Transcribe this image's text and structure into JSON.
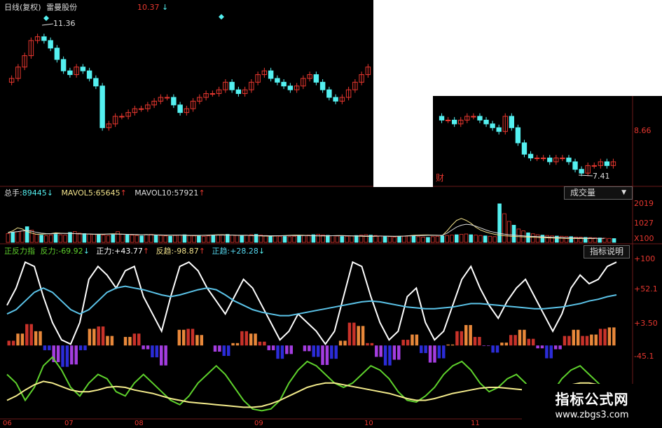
{
  "price_panel": {
    "title": "日线(复权)",
    "stock_name": "雷曼股份",
    "top_value": "10.37",
    "top_arrow": "↓",
    "high_marker": "11.36",
    "low_marker": "7.41",
    "finance_marker": "财",
    "right_axis_value": "8.66"
  },
  "volume_panel": {
    "label_total": "总手:",
    "total_value": "89445",
    "total_arrow": "↓",
    "label_ma5": "MAVOL5:",
    "ma5_value": "65645",
    "ma5_arrow": "↑",
    "label_ma10": "MAVOL10:",
    "ma10_value": "57921",
    "ma10_arrow": "↑",
    "dropdown_label": "成交量",
    "dropdown_arrow": "▼",
    "axis_top": "2019",
    "axis_mid": "1027",
    "axis_unit": "X100"
  },
  "indicator_panel": {
    "name": "正反力指",
    "label_fanli": "反力:",
    "fanli_value": "-69.92",
    "fanli_arrow": "↓",
    "label_zhengli": "正力:",
    "zhengli_value": "+43.77",
    "zhengli_arrow": "↑",
    "label_fanqu": "反趋:",
    "fanqu_value": "-98.87",
    "fanqu_arrow": "↑",
    "label_zhengqu": "正趋:",
    "zhengqu_value": "+28.28",
    "zhengqu_arrow": "↓",
    "help_button": "指标说明",
    "axis_labels": [
      "+100",
      "+52.1",
      "+3.50",
      "-45.1"
    ]
  },
  "x_axis_labels": [
    "06",
    "07",
    "08",
    "09",
    "10",
    "11"
  ],
  "watermark": {
    "line1": "指标公式网",
    "line2": "www.zbgs3.com"
  },
  "colors": {
    "up": "#e8372f",
    "down": "#54f0f0",
    "ma": "#ffffff",
    "white_line": "#ffffff",
    "blue_line": "#5bc3e8",
    "green_line": "#5ed12c",
    "yellow_line": "#f4ec8c",
    "bar_red": "#c8322a",
    "bar_orange": "#e8883a",
    "bar_blue": "#2b2cd8",
    "bar_purple": "#a43de0",
    "label_yellow": "#f0e08a",
    "label_green": "#5ed12c",
    "label_cyan": "#55d8f0"
  },
  "chart_data": [
    {
      "type": "candlestick",
      "title": "日线(复权) 雷曼股份",
      "ylim": [
        7.2,
        11.6
      ],
      "series": [
        {
          "name": "segment1",
          "open": [
            9.8,
            9.9,
            10.2,
            10.5,
            10.9,
            11.0,
            10.9,
            10.7,
            10.4,
            10.1,
            10.0,
            10.2,
            10.1,
            9.9,
            9.7,
            8.6,
            8.7,
            8.9,
            8.9,
            9.0,
            9.1,
            9.1,
            9.2,
            9.3,
            9.4,
            9.4,
            9.2,
            9.0,
            9.1,
            9.3,
            9.4,
            9.5,
            9.5,
            9.6,
            9.8,
            9.6,
            9.5,
            9.6,
            9.8,
            10.0,
            10.1,
            9.9,
            9.8,
            9.7,
            9.6,
            9.7,
            9.9,
            10.0,
            9.8,
            9.6,
            9.4,
            9.3,
            9.4,
            9.6,
            9.8,
            10.0
          ],
          "close": [
            9.9,
            10.2,
            10.5,
            10.9,
            11.0,
            10.9,
            10.7,
            10.4,
            10.1,
            10.0,
            10.2,
            10.1,
            9.9,
            9.7,
            8.6,
            8.7,
            8.9,
            8.9,
            9.0,
            9.1,
            9.1,
            9.2,
            9.3,
            9.4,
            9.4,
            9.2,
            9.0,
            9.1,
            9.3,
            9.4,
            9.5,
            9.5,
            9.6,
            9.8,
            9.6,
            9.5,
            9.6,
            9.8,
            10.0,
            10.1,
            9.9,
            9.8,
            9.7,
            9.6,
            9.7,
            9.9,
            10.0,
            9.8,
            9.6,
            9.4,
            9.3,
            9.4,
            9.6,
            9.8,
            10.0,
            10.2
          ]
        },
        {
          "name": "segment2",
          "open": [
            8.9,
            8.8,
            8.8,
            8.7,
            8.8,
            8.9,
            8.9,
            8.8,
            8.7,
            8.6,
            8.5,
            8.9,
            8.6,
            8.2,
            7.9,
            7.8,
            7.8,
            7.8,
            7.7,
            7.8,
            7.8,
            7.7,
            7.5,
            7.4,
            7.6,
            7.6,
            7.7,
            7.6
          ],
          "close": [
            8.8,
            8.8,
            8.7,
            8.8,
            8.9,
            8.9,
            8.8,
            8.7,
            8.6,
            8.5,
            8.9,
            8.6,
            8.2,
            7.9,
            7.8,
            7.8,
            7.8,
            7.7,
            7.8,
            7.8,
            7.7,
            7.5,
            7.4,
            7.6,
            7.6,
            7.7,
            7.6,
            7.7
          ]
        }
      ],
      "annotations": [
        "11.36",
        "7.41",
        "10.37",
        "8.66"
      ]
    },
    {
      "type": "bar",
      "title": "成交量",
      "ylim": [
        0,
        2200
      ],
      "series": [
        {
          "name": "总手",
          "values": [
            460,
            520,
            560,
            600,
            820,
            640,
            420,
            380,
            350,
            380,
            420,
            400,
            380,
            520,
            560,
            480,
            460,
            440,
            420,
            400,
            380,
            360,
            400,
            560,
            420,
            400,
            380,
            360,
            340,
            400,
            420,
            380,
            360,
            340,
            320,
            360,
            380,
            400,
            360,
            340,
            330,
            320,
            340,
            360,
            380,
            400,
            420,
            380,
            360,
            340,
            380,
            400,
            420,
            380,
            360,
            340,
            330,
            320,
            310,
            300,
            320,
            340,
            360,
            380,
            400,
            420,
            390,
            370,
            350,
            330,
            310,
            320,
            340,
            360,
            380,
            400,
            380,
            360,
            340,
            320,
            300,
            280,
            300,
            320,
            340,
            360,
            300,
            280,
            260,
            300,
            320,
            340,
            360,
            380,
            400,
            420,
            440,
            400,
            380,
            360,
            340,
            320,
            300,
            2019,
            1500,
            1100,
            900,
            700,
            600,
            500,
            450,
            400,
            380,
            360,
            340,
            330,
            320,
            310,
            300,
            280,
            270,
            260,
            250,
            240,
            230,
            220,
            210,
            200
          ]
        },
        {
          "name": "MAVOL5",
          "values": [
            520,
            600,
            760,
            700,
            560,
            480,
            420,
            430,
            440,
            460,
            500,
            480,
            470,
            470,
            460,
            450,
            440,
            430,
            420,
            410,
            420,
            440,
            450,
            440,
            430,
            420,
            410,
            400,
            400,
            410,
            400,
            390,
            380,
            370,
            370,
            380,
            380,
            370,
            360,
            360,
            360,
            370,
            380,
            390,
            400,
            400,
            390,
            380,
            370,
            370,
            370,
            360,
            350,
            340,
            330,
            330,
            340,
            350,
            360,
            370,
            380,
            380,
            370,
            360,
            350,
            340,
            340,
            340,
            350,
            360,
            360,
            350,
            340,
            330,
            320,
            310,
            310,
            320,
            330,
            330,
            320,
            310,
            320,
            330,
            350,
            370,
            380,
            390,
            390,
            380,
            370,
            360,
            600,
            900,
            1150,
            1250,
            1150,
            1000,
            800,
            650,
            550,
            480,
            420,
            380,
            350,
            330,
            310,
            300,
            290,
            280,
            270,
            260,
            250,
            240,
            230,
            220,
            220,
            210,
            210,
            200,
            200,
            200,
            200,
            200
          ]
        },
        {
          "name": "MAVOL10",
          "values": [
            500,
            540,
            560,
            600,
            620,
            580,
            520,
            480,
            460,
            450,
            460,
            470,
            470,
            470,
            460,
            450,
            440,
            440,
            430,
            430,
            430,
            430,
            430,
            430,
            420,
            420,
            410,
            410,
            400,
            400,
            400,
            390,
            390,
            380,
            380,
            380,
            380,
            380,
            370,
            370,
            370,
            370,
            370,
            380,
            380,
            380,
            380,
            380,
            370,
            370,
            370,
            360,
            360,
            350,
            350,
            350,
            350,
            350,
            350,
            360,
            360,
            360,
            360,
            360,
            350,
            350,
            350,
            350,
            350,
            350,
            350,
            350,
            340,
            340,
            340,
            330,
            330,
            330,
            330,
            330,
            320,
            320,
            320,
            330,
            340,
            350,
            360,
            360,
            370,
            370,
            370,
            370,
            480,
            640,
            800,
            900,
            950,
            920,
            850,
            760,
            660,
            580,
            520,
            470,
            430,
            400,
            380,
            360,
            340,
            320,
            310,
            300,
            290,
            280,
            270,
            260,
            250,
            240,
            240,
            230,
            230,
            220,
            220,
            210,
            210,
            210
          ]
        }
      ],
      "annotations": [
        "2019",
        "1027",
        "X100"
      ]
    },
    {
      "type": "line",
      "title": "正反力指",
      "ylim": [
        -75,
        105
      ],
      "series": [
        {
          "name": "正力",
          "values": [
            50,
            70,
            100,
            95,
            60,
            30,
            10,
            5,
            30,
            80,
            95,
            85,
            70,
            90,
            95,
            60,
            40,
            20,
            60,
            95,
            100,
            90,
            70,
            55,
            40,
            60,
            80,
            70,
            50,
            30,
            10,
            20,
            40,
            30,
            20,
            5,
            20,
            60,
            100,
            95,
            60,
            30,
            10,
            20,
            60,
            70,
            30,
            10,
            20,
            50,
            80,
            95,
            70,
            50,
            35,
            55,
            70,
            80,
            60,
            40,
            20,
            40,
            70,
            85,
            75,
            80,
            95,
            100
          ]
        },
        {
          "name": "正趋",
          "values": [
            40,
            45,
            55,
            65,
            70,
            65,
            55,
            45,
            40,
            45,
            55,
            65,
            70,
            72,
            70,
            68,
            65,
            62,
            60,
            62,
            65,
            68,
            70,
            68,
            62,
            55,
            50,
            45,
            42,
            40,
            38,
            38,
            40,
            42,
            44,
            46,
            48,
            50,
            52,
            54,
            55,
            54,
            52,
            50,
            48,
            47,
            46,
            46,
            47,
            48,
            50,
            52,
            52,
            51,
            50,
            49,
            48,
            47,
            46,
            46,
            47,
            48,
            50,
            52,
            55,
            57,
            60,
            62
          ]
        },
        {
          "name": "反力",
          "values": [
            -30,
            -40,
            -60,
            -45,
            -20,
            -10,
            -25,
            -45,
            -55,
            -40,
            -30,
            -35,
            -50,
            -55,
            -40,
            -30,
            -40,
            -50,
            -60,
            -65,
            -55,
            -40,
            -30,
            -20,
            -30,
            -45,
            -60,
            -70,
            -72,
            -70,
            -60,
            -40,
            -25,
            -15,
            -20,
            -30,
            -40,
            -45,
            -40,
            -30,
            -20,
            -25,
            -35,
            -50,
            -60,
            -62,
            -55,
            -45,
            -30,
            -20,
            -15,
            -25,
            -40,
            -50,
            -45,
            -35,
            -30,
            -40,
            -55,
            -60,
            -50,
            -35,
            -25,
            -20,
            -30,
            -40,
            -50,
            -55
          ]
        },
        {
          "name": "反趋",
          "values": [
            -60,
            -55,
            -48,
            -42,
            -38,
            -40,
            -44,
            -48,
            -50,
            -50,
            -48,
            -45,
            -44,
            -45,
            -48,
            -50,
            -52,
            -55,
            -58,
            -60,
            -62,
            -63,
            -64,
            -65,
            -66,
            -67,
            -68,
            -68,
            -67,
            -64,
            -60,
            -55,
            -50,
            -45,
            -42,
            -40,
            -40,
            -42,
            -44,
            -46,
            -48,
            -50,
            -52,
            -55,
            -58,
            -60,
            -60,
            -58,
            -55,
            -52,
            -50,
            -48,
            -46,
            -45,
            -45,
            -46,
            -47,
            -48,
            -48,
            -47,
            -46,
            -44,
            -42,
            -40,
            -40,
            -42,
            -45,
            -48
          ]
        }
      ],
      "annotations": [
        "+100",
        "+52.1",
        "+3.50",
        "-45.1"
      ]
    }
  ]
}
